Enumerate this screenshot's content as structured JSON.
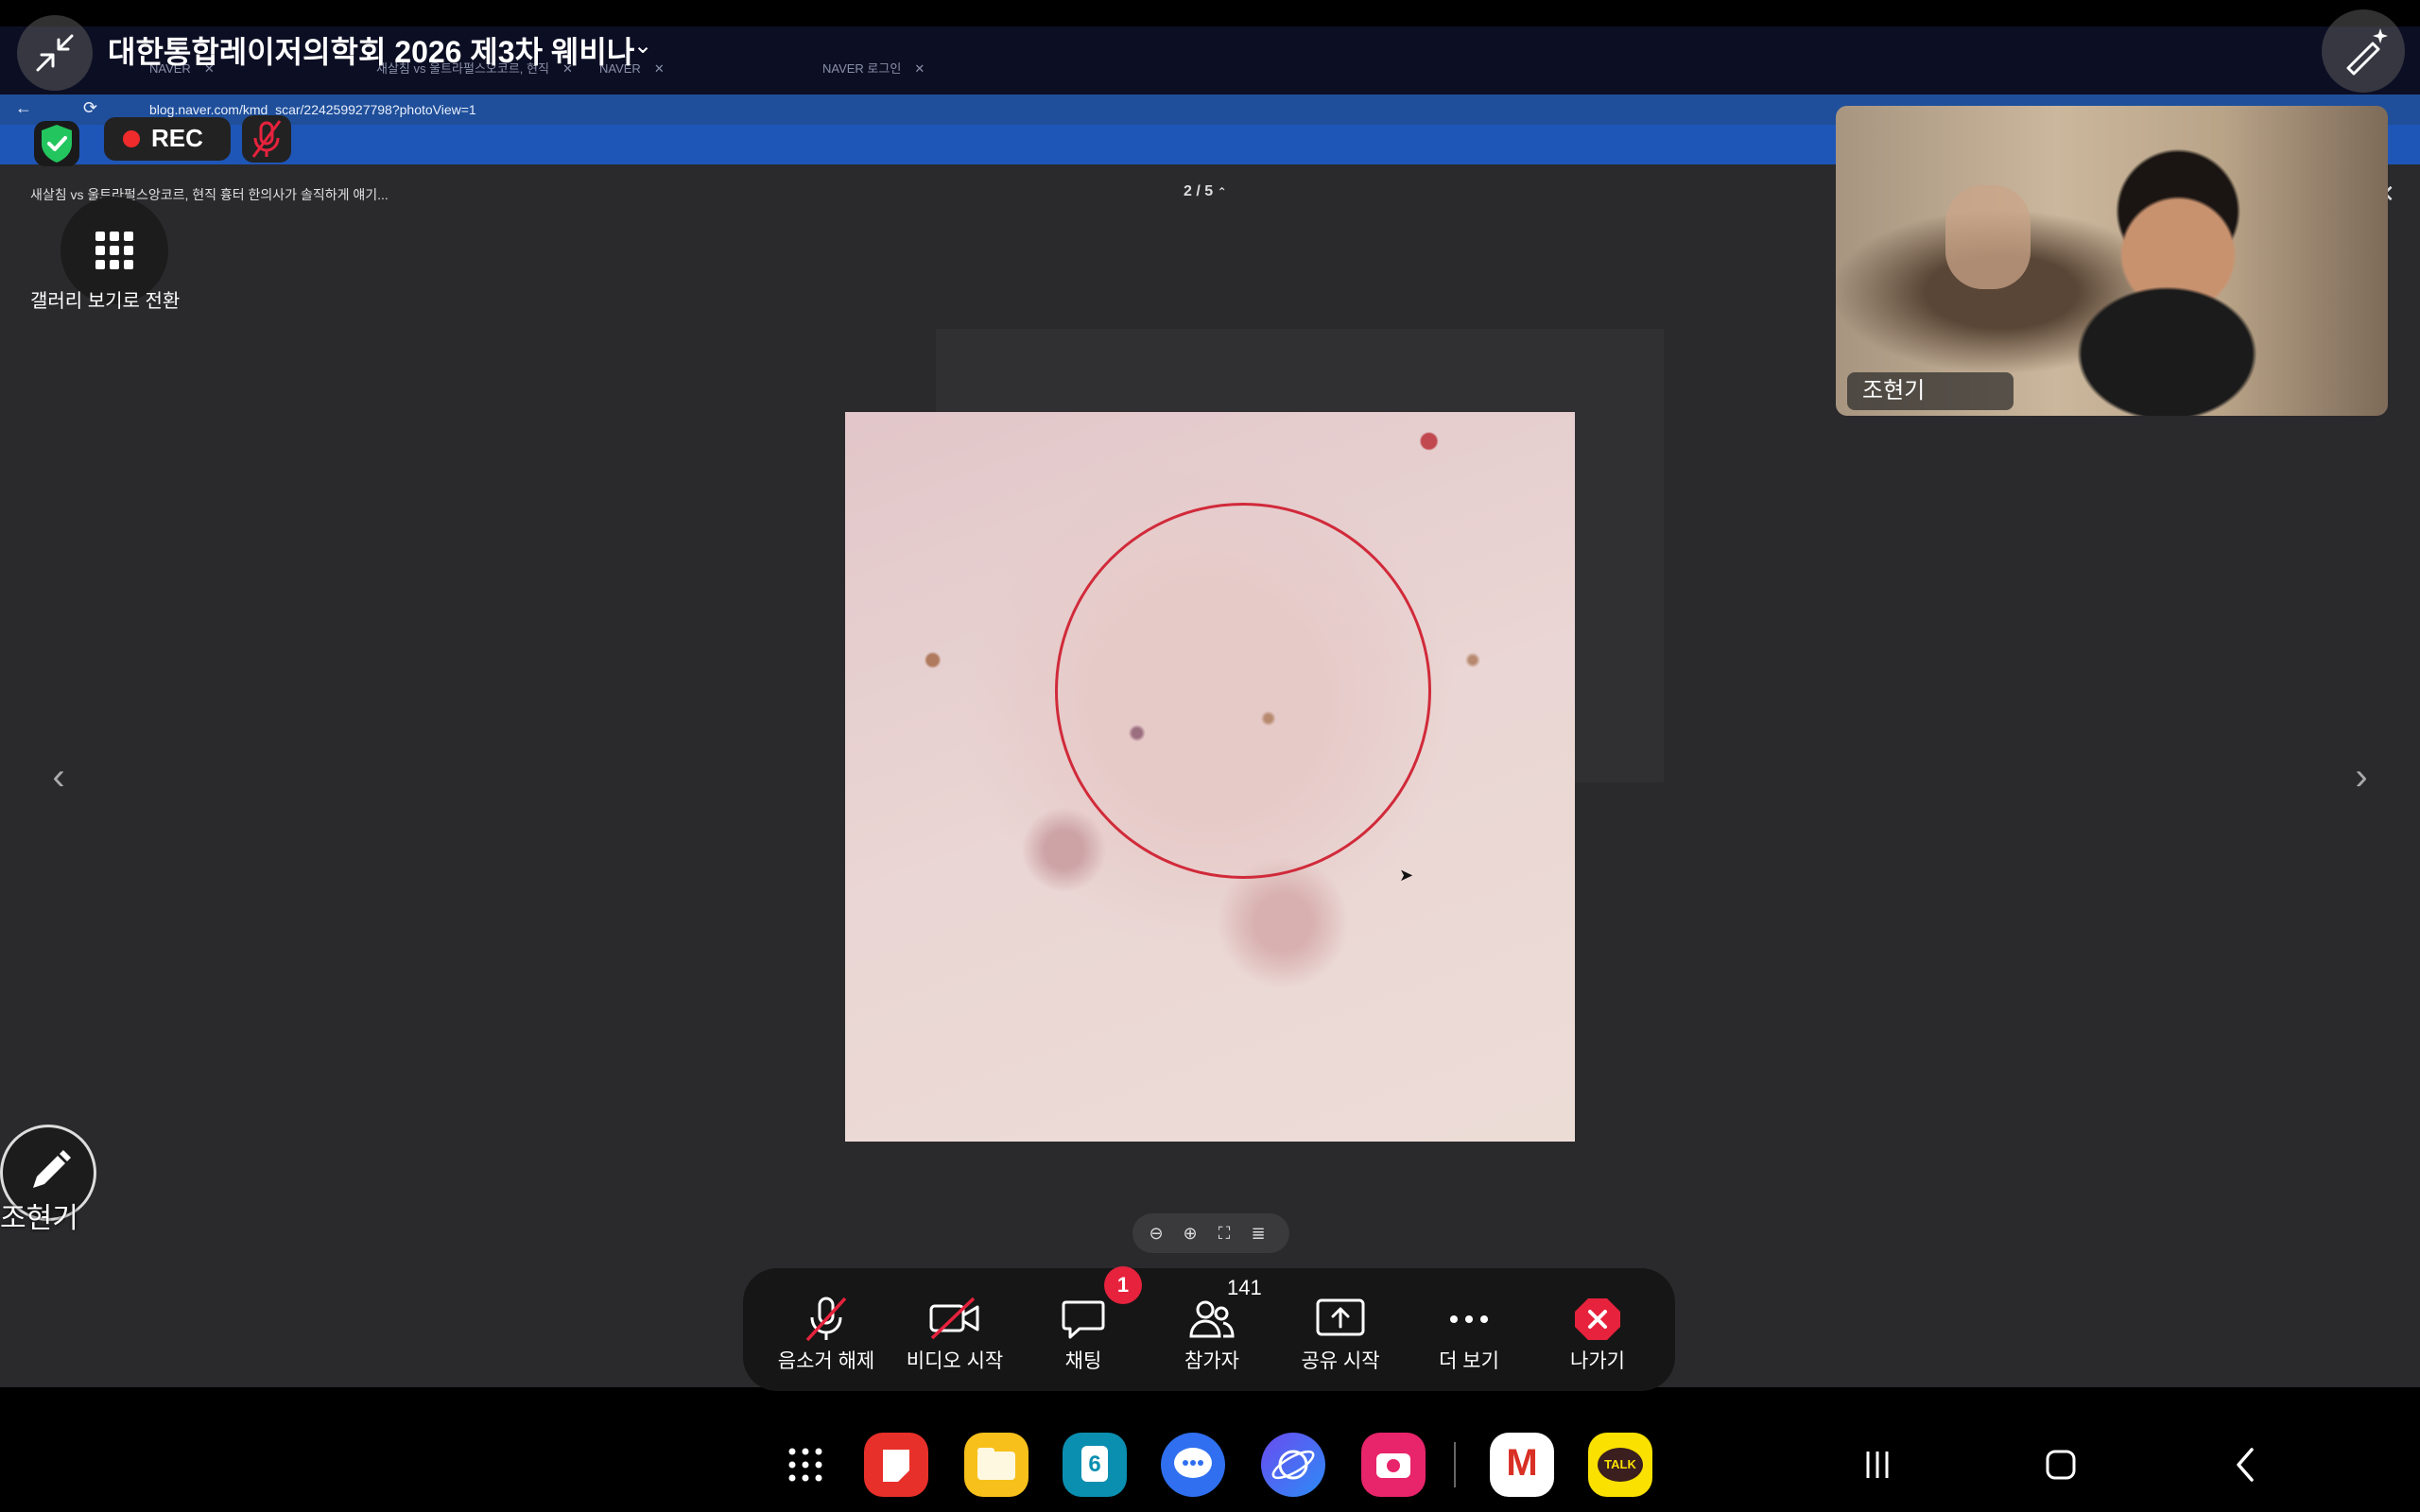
{
  "meeting": {
    "title": "대한통합레이저의학회 2026 제3차 웨비나",
    "rec_label": "REC",
    "gallery_switch_label": "갤러리 보기로 전환",
    "speaker_name": "조현기",
    "annotate_name": "조현기"
  },
  "shared_screen": {
    "url": "blog.naver.com/kmd_scar/224259927798?photoView=1",
    "tabs": [
      "NAVER",
      "새살침 vs 울트라펄스오코르, 현직",
      "NAVER",
      "NAVER 로그인"
    ],
    "blog_title": "새살침 vs 울트라펄스앙코르, 현직 흉터 한의사가 솔직하게 얘기...",
    "photo_counter": "2 / 5"
  },
  "toolbar": {
    "items": [
      {
        "label": "음소거 해제",
        "icon": "mic-off-icon"
      },
      {
        "label": "비디오 시작",
        "icon": "video-off-icon"
      },
      {
        "label": "채팅",
        "icon": "chat-icon"
      },
      {
        "label": "참가자",
        "icon": "participants-icon"
      },
      {
        "label": "공유 시작",
        "icon": "share-icon"
      },
      {
        "label": "더 보기",
        "icon": "more-icon"
      },
      {
        "label": "나가기",
        "icon": "leave-icon"
      }
    ],
    "chat_badge": "1",
    "participant_count": "141"
  },
  "dock": {
    "calendar_day": "6",
    "talk_label": "TALK",
    "gmail_label": "M"
  },
  "colors": {
    "rec_red": "#ef2b2b",
    "leave_red": "#e7223d",
    "badge_red": "#e7223d",
    "secure_green": "#22c55e",
    "photo_circle": "#d12a3a"
  }
}
